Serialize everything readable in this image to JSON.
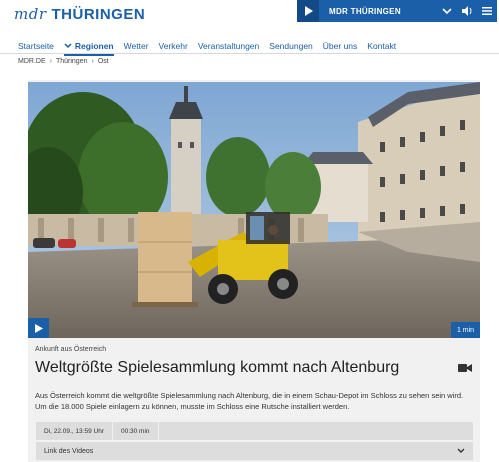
{
  "brand": {
    "prefix": "mdr",
    "state": "THÜRINGEN",
    "color": "#1b5fa8"
  },
  "radio": {
    "label": "MDR THÜRINGEN",
    "play_icon": "play-icon",
    "chevron_icon": "chevron-down-icon",
    "volume_icon": "volume-icon",
    "menu_icon": "menu-icon"
  },
  "nav": {
    "items": [
      {
        "label": "Startseite"
      },
      {
        "label": "Regionen",
        "active": true
      },
      {
        "label": "Wetter"
      },
      {
        "label": "Verkehr"
      },
      {
        "label": "Veranstaltungen"
      },
      {
        "label": "Sendungen"
      },
      {
        "label": "Über uns"
      },
      {
        "label": "Kontakt"
      }
    ]
  },
  "breadcrumb": [
    "MDR.DE",
    "Thüringen",
    "Ost"
  ],
  "article": {
    "kicker": "Ankunft aus Österreich",
    "title": "Weltgrößte Spielesammlung kommt nach Altenburg",
    "teaser": "Aus Österreich kommt die weltgrößte Spielesammlung nach Altenburg, die in einem Schau-Depot im Schloss zu sehen sein wird. Um die 18.000 Spiele einlagern zu können, musste im Schloss eine Rutsche installiert werden.",
    "duration_badge": "1 min",
    "date": "Di, 22.09., 13:59 Uhr",
    "length": "00:30 min",
    "links_label": "Link des Videos"
  }
}
